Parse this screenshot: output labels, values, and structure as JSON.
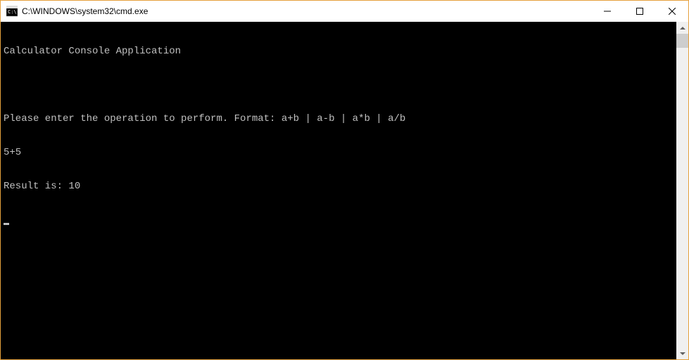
{
  "window": {
    "title": "C:\\WINDOWS\\system32\\cmd.exe"
  },
  "console": {
    "lines": [
      "Calculator Console Application",
      "",
      "Please enter the operation to perform. Format: a+b | a-b | a*b | a/b",
      "5+5",
      "Result is: 10"
    ]
  }
}
